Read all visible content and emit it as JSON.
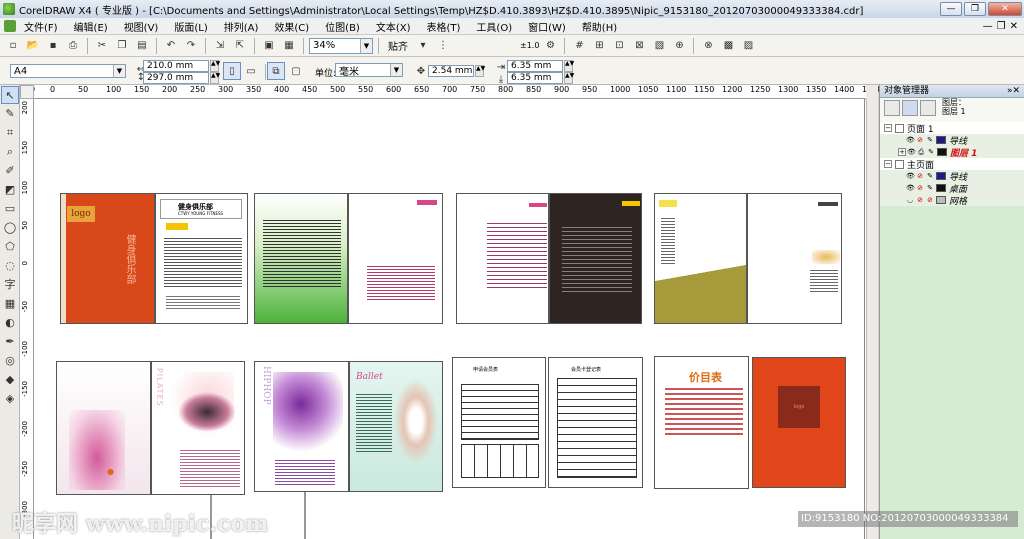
{
  "window": {
    "title": "CorelDRAW X4 ( 专业版 ) - [C:\\Documents and Settings\\Administrator\\Local Settings\\Temp\\HZ$D.410.3893\\HZ$D.410.3895\\Nipic_9153180_20120703000049333384.cdr]",
    "minimize": "—",
    "maximize": "❐",
    "close": "✕"
  },
  "menu": {
    "items": [
      "文件(F)",
      "编辑(E)",
      "视图(V)",
      "版面(L)",
      "排列(A)",
      "效果(C)",
      "位图(B)",
      "文本(X)",
      "表格(T)",
      "工具(O)",
      "窗口(W)",
      "帮助(H)"
    ],
    "doc_controls": [
      "—",
      "❐",
      "✕"
    ]
  },
  "toolbar": {
    "zoom": "34%",
    "snap_label": "贴齐",
    "launch": "±1.0"
  },
  "property_bar": {
    "paper_size": "A4",
    "width": "210.0 mm",
    "height": "297.0 mm",
    "unit_label": "单位:",
    "unit_value": "毫米",
    "nudge": "2.54 mm",
    "dup_x": "6.35 mm",
    "dup_y": "6.35 mm"
  },
  "rulers": {
    "top": [
      "-50",
      "0",
      "50",
      "100",
      "150",
      "200",
      "250",
      "300",
      "350",
      "400",
      "450",
      "500",
      "550",
      "600",
      "650",
      "700",
      "750",
      "800",
      "850",
      "900",
      "950",
      "1000",
      "1050",
      "1100",
      "1150",
      "1200",
      "1250",
      "1300",
      "1350",
      "1400",
      "1450"
    ],
    "left": [
      "200",
      "150",
      "100",
      "50",
      "0",
      "-50",
      "-100",
      "-150",
      "-200",
      "-250",
      "-300"
    ]
  },
  "object_manager": {
    "title": "对象管理器",
    "layer_line1": "图层：",
    "layer_line2": "图层 1",
    "tree": [
      {
        "label": "页面 1",
        "level": 0,
        "expander": "−"
      },
      {
        "label": "导线",
        "level": 1,
        "expander": "",
        "color": "#1e1a8a"
      },
      {
        "label": "图层 1",
        "level": 1,
        "expander": "+",
        "color": "#111111",
        "accent": "#d01010"
      },
      {
        "label": "主页面",
        "level": 0,
        "expander": "−"
      },
      {
        "label": "导线",
        "level": 1,
        "expander": "",
        "color": "#1e1a8a"
      },
      {
        "label": "桌面",
        "level": 1,
        "expander": "",
        "color": "#111111"
      },
      {
        "label": "网格",
        "level": 1,
        "expander": "",
        "color": "#bbbbbb"
      }
    ]
  },
  "page_text": {
    "logo": "logo",
    "club_title": "健身俱乐部",
    "club_sub": "CTWY YOUNG FITNESS",
    "pilates": "PILATES",
    "hiphop": "HIPHOP",
    "ballet": "Ballet",
    "price_title": "价目表",
    "form_title_1": "申请会员表",
    "form_title_2": "会员卡登记表"
  },
  "watermark": {
    "left": "昵享网 www.nipic.com",
    "right": "ID:9153180 NO:20120703000049333384"
  }
}
